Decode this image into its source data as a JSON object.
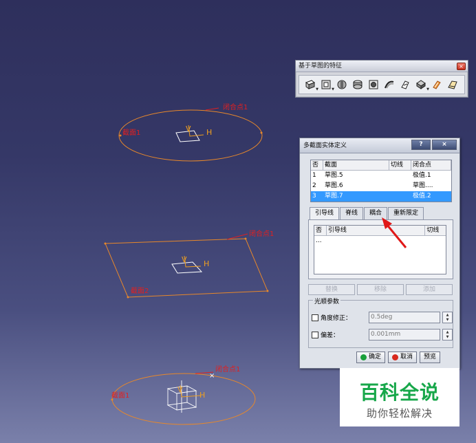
{
  "scene": {
    "top_sketch": {
      "section_label": "截面1",
      "closing_label": "闭合点1"
    },
    "mid_sketch": {
      "section_label": "截面2",
      "closing_label": "闭合点1"
    },
    "bottom_sketch": {
      "section_label": "截面1",
      "closing_label": "闭合点1"
    },
    "axis_v": "V",
    "axis_h": "H",
    "colors": {
      "curve": "#e8882a",
      "label": "#e02020",
      "axis": "#f0a020",
      "sketch": "#ffffff"
    }
  },
  "toolbar": {
    "title": "基于草图的特征",
    "close_glyph": "×",
    "icons": [
      "pad-icon",
      "pocket-icon",
      "shaft-icon",
      "groove-icon",
      "hole-icon",
      "rib-icon",
      "slot-icon",
      "solid-combine-icon",
      "multi-pad-icon",
      "multi-section-solid-icon"
    ]
  },
  "dialog": {
    "title": "多截面实体定义",
    "help_glyph": "?",
    "close_glyph": "×",
    "sections_table": {
      "headers": [
        "否",
        "截面",
        "切线",
        "闭合点"
      ],
      "rows": [
        {
          "no": "1",
          "section": "草图.5",
          "tangent": "",
          "closing": "极值.1"
        },
        {
          "no": "2",
          "section": "草图.6",
          "tangent": "",
          "closing": "草图...."
        },
        {
          "no": "3",
          "section": "草图.7",
          "tangent": "",
          "closing": "极值.2"
        }
      ]
    },
    "tabs": [
      "引导线",
      "脊线",
      "耦合",
      "重新限定"
    ],
    "guides_table": {
      "headers": [
        "否",
        "引导线",
        "切线"
      ],
      "rows": [
        {
          "no": "...",
          "guide": "",
          "tangent": ""
        }
      ]
    },
    "actions": [
      "替换",
      "移除",
      "添加"
    ],
    "smooth": {
      "title": "光顺参数",
      "angle_label": "角度修正：",
      "angle_value": "0.5deg",
      "deviation_label": "偏差：",
      "deviation_value": "0.001mm"
    },
    "buttons": {
      "ok": "确定",
      "cancel": "取消",
      "preview": "预览"
    },
    "colors": {
      "selected_row": "#3399ff",
      "ok_dot": "#1aa03a",
      "cancel_dot": "#d8281c",
      "arrow": "#e01818"
    }
  },
  "watermark": {
    "main": "百科全说",
    "sub": "助你轻松解决"
  }
}
